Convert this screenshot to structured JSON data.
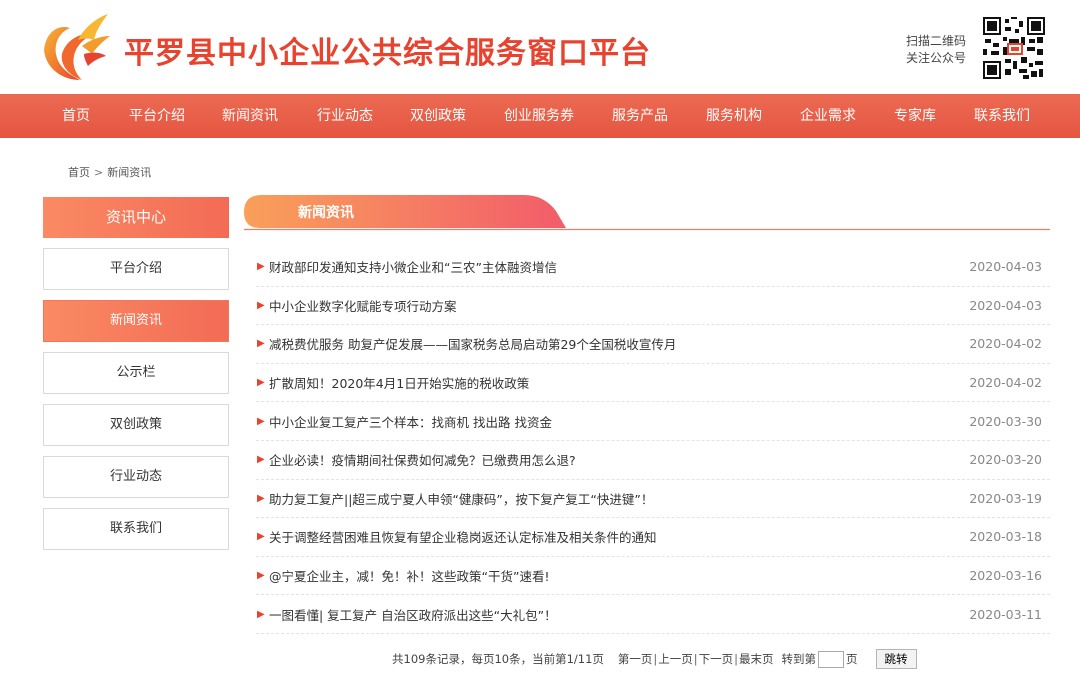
{
  "header": {
    "site_title": "平罗县中小企业公共综合服务窗口平台",
    "qr_line1": "扫描二维码",
    "qr_line2": "关注公众号"
  },
  "nav": [
    {
      "label": "首页"
    },
    {
      "label": "平台介绍"
    },
    {
      "label": "新闻资讯"
    },
    {
      "label": "行业动态"
    },
    {
      "label": "双创政策"
    },
    {
      "label": "创业服务券"
    },
    {
      "label": "服务产品"
    },
    {
      "label": "服务机构"
    },
    {
      "label": "企业需求"
    },
    {
      "label": "专家库"
    },
    {
      "label": "联系我们"
    }
  ],
  "breadcrumb": {
    "home": "首页",
    "separator": ">",
    "current": "新闻资讯"
  },
  "sidebar": {
    "heading": "资讯中心",
    "items": [
      {
        "label": "平台介绍"
      },
      {
        "label": "新闻资讯",
        "active": true
      },
      {
        "label": "公示栏"
      },
      {
        "label": "双创政策"
      },
      {
        "label": "行业动态"
      },
      {
        "label": "联系我们"
      }
    ]
  },
  "section": {
    "title": "新闻资讯"
  },
  "news": [
    {
      "title": "财政部印发通知支持小微企业和“三农”主体融资增信",
      "date": "2020-04-03"
    },
    {
      "title": "中小企业数字化赋能专项行动方案",
      "date": "2020-04-03"
    },
    {
      "title": "减税费优服务 助复产促发展——国家税务总局启动第29个全国税收宣传月",
      "date": "2020-04-02"
    },
    {
      "title": "扩散周知！2020年4月1日开始实施的税收政策",
      "date": "2020-04-02"
    },
    {
      "title": "中小企业复工复产三个样本：找商机 找出路 找资金",
      "date": "2020-03-30"
    },
    {
      "title": "企业必读！疫情期间社保费如何减免？已缴费用怎么退?",
      "date": "2020-03-20"
    },
    {
      "title": "助力复工复产||超三成宁夏人申领“健康码”，按下复产复工“快进键”！",
      "date": "2020-03-19"
    },
    {
      "title": "关于调整经营困难且恢复有望企业稳岗返还认定标准及相关条件的通知",
      "date": "2020-03-18"
    },
    {
      "title": "@宁夏企业主，减！免！补！这些政策“干货”速看!",
      "date": "2020-03-16"
    },
    {
      "title": "一图看懂| 复工复产 自治区政府派出这些“大礼包”！",
      "date": "2020-03-11"
    }
  ],
  "pager": {
    "summary": "共109条记录，每页10条，当前第1/11页",
    "first": "第一页",
    "prev": "上一页",
    "next": "下一页",
    "last": "最末页",
    "goto_prefix": "转到第",
    "goto_suffix": "页",
    "jump": "跳转",
    "goto_value": ""
  },
  "colors": {
    "brand": "#e8432e",
    "nav": "#e95d46",
    "accent": "#f47657"
  },
  "icons": {
    "logo": "phoenix-logo-icon",
    "qr": "qr-code-icon",
    "arrow": "triangle-right-icon"
  }
}
